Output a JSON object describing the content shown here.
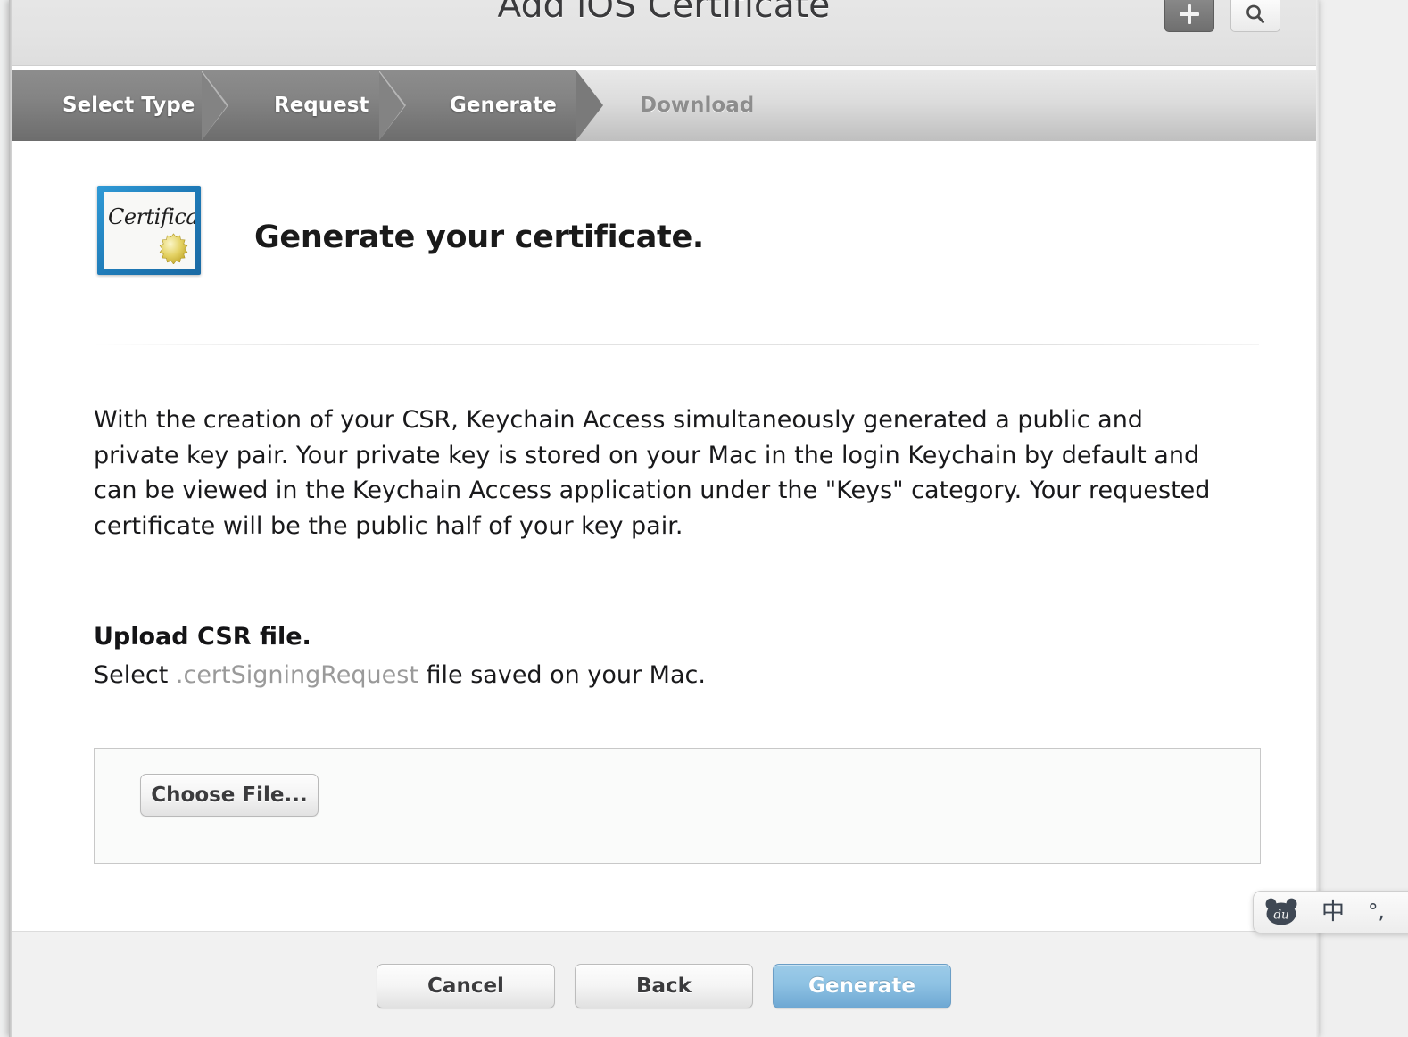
{
  "window": {
    "title": "Add iOS Certificate"
  },
  "header": {
    "add_button_icon": "plus-icon",
    "search_button_icon": "search-icon"
  },
  "steps": [
    {
      "label": "Select Type",
      "state": "done"
    },
    {
      "label": "Request",
      "state": "done"
    },
    {
      "label": "Generate",
      "state": "current"
    },
    {
      "label": "Download",
      "state": "upcoming"
    }
  ],
  "main": {
    "icon_label": "Certificate",
    "icon_name": "certificate-icon",
    "heading": "Generate your certificate.",
    "paragraph": "With the creation of your CSR, Keychain Access simultaneously generated a public and private key pair. Your private key is stored on your Mac in the login Keychain by default and can be viewed in the Keychain Access application under the \"Keys\" category. Your requested certificate will be the public half of your key pair.",
    "upload": {
      "title": "Upload CSR file.",
      "subtitle_before": "Select ",
      "subtitle_extension": ".certSigningRequest",
      "subtitle_after": " file saved on your Mac.",
      "choose_file_label": "Choose File..."
    }
  },
  "footer": {
    "cancel_label": "Cancel",
    "back_label": "Back",
    "generate_label": "Generate"
  },
  "ime": {
    "logo_text": "du",
    "mode_label": "中",
    "punctuation_label": "°,"
  },
  "colors": {
    "accent_blue": "#8ec2e3",
    "step_active_bg": "#7d7d7d",
    "step_inactive_text": "#8d8d8d",
    "certificate_border": "#1f7bb8",
    "seal_gold": "#d8c13f",
    "extension_text": "#9a9a9a"
  }
}
